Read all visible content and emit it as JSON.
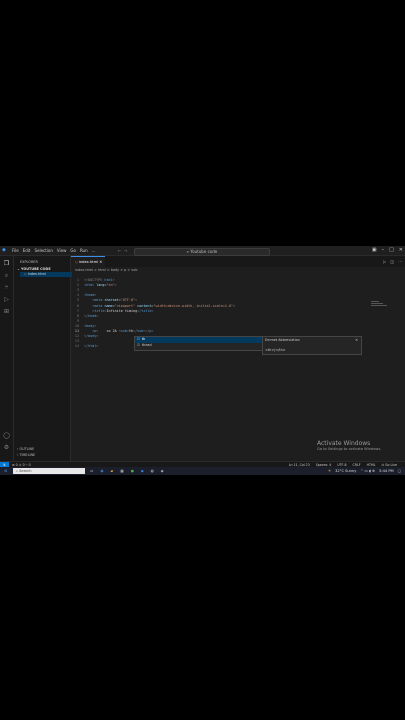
{
  "titlebar": {
    "menu": [
      "File",
      "Edit",
      "Selection",
      "View",
      "Go",
      "Run",
      "..."
    ],
    "command_center": "Youtube code"
  },
  "sidebar": {
    "title": "EXPLORER",
    "folder": "YOUTUBE CODE",
    "file": "index.html",
    "outline": "OUTLINE",
    "timeline": "TIMELINE"
  },
  "tab": {
    "label": "index.html"
  },
  "breadcrumb": "index.html > html > body > p > sub",
  "editor": {
    "lines": [
      {
        "n": "1",
        "segments": [
          {
            "t": "<!DOCTYPE ",
            "c": "gr"
          },
          {
            "t": "html",
            "c": "kw"
          },
          {
            "t": ">",
            "c": "gr"
          }
        ]
      },
      {
        "n": "2",
        "segments": [
          {
            "t": "<",
            "c": "gr"
          },
          {
            "t": "html ",
            "c": "kw"
          },
          {
            "t": "lang",
            "c": "at"
          },
          {
            "t": "=",
            "c": "tx"
          },
          {
            "t": "\"en\"",
            "c": "st"
          },
          {
            "t": ">",
            "c": "gr"
          }
        ]
      },
      {
        "n": "3",
        "segments": []
      },
      {
        "n": "4",
        "segments": [
          {
            "t": "<",
            "c": "gr"
          },
          {
            "t": "head",
            "c": "kw"
          },
          {
            "t": ">",
            "c": "gr"
          }
        ]
      },
      {
        "n": "5",
        "segments": [
          {
            "t": "    <",
            "c": "gr"
          },
          {
            "t": "meta ",
            "c": "kw"
          },
          {
            "t": "charset",
            "c": "at"
          },
          {
            "t": "=",
            "c": "tx"
          },
          {
            "t": "\"UTF-8\"",
            "c": "st"
          },
          {
            "t": ">",
            "c": "gr"
          }
        ]
      },
      {
        "n": "6",
        "segments": [
          {
            "t": "    <",
            "c": "gr"
          },
          {
            "t": "meta ",
            "c": "kw"
          },
          {
            "t": "name",
            "c": "at"
          },
          {
            "t": "=",
            "c": "tx"
          },
          {
            "t": "\"viewport\" ",
            "c": "st"
          },
          {
            "t": "content",
            "c": "at"
          },
          {
            "t": "=",
            "c": "tx"
          },
          {
            "t": "\"width=device-width, initial-scale=1.0\"",
            "c": "st"
          },
          {
            "t": ">",
            "c": "gr"
          }
        ]
      },
      {
        "n": "7",
        "segments": [
          {
            "t": "    <",
            "c": "gr"
          },
          {
            "t": "title",
            "c": "kw"
          },
          {
            "t": ">",
            "c": "gr"
          },
          {
            "t": "Infinite timing",
            "c": "tx"
          },
          {
            "t": "</",
            "c": "gr"
          },
          {
            "t": "title",
            "c": "kw"
          },
          {
            "t": ">",
            "c": "gr"
          }
        ]
      },
      {
        "n": "8",
        "segments": [
          {
            "t": "</",
            "c": "gr"
          },
          {
            "t": "head",
            "c": "kw"
          },
          {
            "t": ">",
            "c": "gr"
          }
        ]
      },
      {
        "n": "9",
        "segments": []
      },
      {
        "n": "10",
        "segments": [
          {
            "t": "<",
            "c": "gr"
          },
          {
            "t": "body",
            "c": "kw"
          },
          {
            "t": ">",
            "c": "gr"
          }
        ]
      },
      {
        "n": "11",
        "segments": [
          {
            "t": "    <",
            "c": "gr"
          },
          {
            "t": "p",
            "c": "kw"
          },
          {
            "t": ">    ",
            "c": "gr"
          },
          {
            "t": "co 2A ",
            "c": "tx"
          },
          {
            "t": "<",
            "c": "gr"
          },
          {
            "t": "sub",
            "c": "kw"
          },
          {
            "t": ">",
            "c": "gr"
          },
          {
            "t": "th",
            "c": "tx"
          },
          {
            "t": "</",
            "c": "gr"
          },
          {
            "t": "sub",
            "c": "kw"
          },
          {
            "t": "></",
            "c": "gr"
          },
          {
            "t": "p",
            "c": "kw"
          },
          {
            "t": ">",
            "c": "gr"
          }
        ]
      },
      {
        "n": "12",
        "segments": [
          {
            "t": "</",
            "c": "gr"
          },
          {
            "t": "body",
            "c": "kw"
          },
          {
            "t": ">",
            "c": "gr"
          }
        ]
      },
      {
        "n": "13",
        "segments": []
      },
      {
        "n": "14",
        "segments": [
          {
            "t": "</",
            "c": "gr"
          },
          {
            "t": "html",
            "c": "kw"
          },
          {
            "t": ">",
            "c": "gr"
          }
        ]
      }
    ],
    "suggestions": [
      "th",
      "thead"
    ],
    "detail_title": "Emmet Abbreviation",
    "detail_body": "<th>|</th>"
  },
  "statusbar": {
    "left": "⊗ 0 ⚠ 0   ⑂ 0",
    "right": [
      "Ln 11, Col 23",
      "Spaces: 4",
      "UTF-8",
      "CRLF",
      "HTML",
      "⦾ Go Live"
    ]
  },
  "activate": {
    "title": "Activate Windows",
    "subtitle": "Go to Settings to activate Windows."
  },
  "taskbar": {
    "search": "Search",
    "weather": "32°C  Sunny",
    "time": "5:44 PM"
  },
  "colors": {
    "accent": "#0078d4",
    "selection": "#04395e",
    "background": "#1e1e1e"
  }
}
